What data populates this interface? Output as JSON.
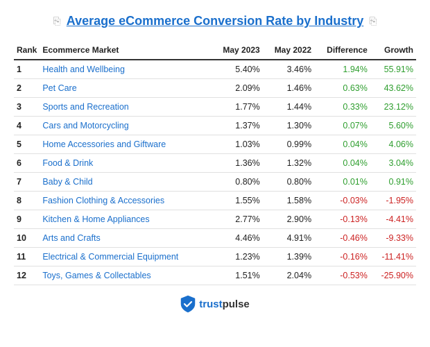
{
  "title": "Average eCommerce Conversion Rate by Industry",
  "table": {
    "headers": [
      "Rank",
      "Ecommerce Market",
      "May 2023",
      "May 2022",
      "Difference",
      "Growth"
    ],
    "rows": [
      {
        "rank": "1",
        "market": "Health and Wellbeing",
        "may2023": "5.40%",
        "may2022": "3.46%",
        "diff": "1.94%",
        "diffSign": "pos",
        "growth": "55.91%",
        "growthSign": "pos"
      },
      {
        "rank": "2",
        "market": "Pet Care",
        "may2023": "2.09%",
        "may2022": "1.46%",
        "diff": "0.63%",
        "diffSign": "pos",
        "growth": "43.62%",
        "growthSign": "pos"
      },
      {
        "rank": "3",
        "market": "Sports and Recreation",
        "may2023": "1.77%",
        "may2022": "1.44%",
        "diff": "0.33%",
        "diffSign": "pos",
        "growth": "23.12%",
        "growthSign": "pos"
      },
      {
        "rank": "4",
        "market": "Cars and Motorcycling",
        "may2023": "1.37%",
        "may2022": "1.30%",
        "diff": "0.07%",
        "diffSign": "pos",
        "growth": "5.60%",
        "growthSign": "pos"
      },
      {
        "rank": "5",
        "market": "Home Accessories and Giftware",
        "may2023": "1.03%",
        "may2022": "0.99%",
        "diff": "0.04%",
        "diffSign": "pos",
        "growth": "4.06%",
        "growthSign": "pos"
      },
      {
        "rank": "6",
        "market": "Food & Drink",
        "may2023": "1.36%",
        "may2022": "1.32%",
        "diff": "0.04%",
        "diffSign": "pos",
        "growth": "3.04%",
        "growthSign": "pos"
      },
      {
        "rank": "7",
        "market": "Baby & Child",
        "may2023": "0.80%",
        "may2022": "0.80%",
        "diff": "0.01%",
        "diffSign": "pos",
        "growth": "0.91%",
        "growthSign": "pos"
      },
      {
        "rank": "8",
        "market": "Fashion Clothing & Accessories",
        "may2023": "1.55%",
        "may2022": "1.58%",
        "diff": "-0.03%",
        "diffSign": "neg",
        "growth": "-1.95%",
        "growthSign": "neg"
      },
      {
        "rank": "9",
        "market": "Kitchen & Home Appliances",
        "may2023": "2.77%",
        "may2022": "2.90%",
        "diff": "-0.13%",
        "diffSign": "neg",
        "growth": "-4.41%",
        "growthSign": "neg"
      },
      {
        "rank": "10",
        "market": "Arts and Crafts",
        "may2023": "4.46%",
        "may2022": "4.91%",
        "diff": "-0.46%",
        "diffSign": "neg",
        "growth": "-9.33%",
        "growthSign": "neg"
      },
      {
        "rank": "11",
        "market": "Electrical & Commercial Equipment",
        "may2023": "1.23%",
        "may2022": "1.39%",
        "diff": "-0.16%",
        "diffSign": "neg",
        "growth": "-11.41%",
        "growthSign": "neg"
      },
      {
        "rank": "12",
        "market": "Toys, Games & Collectables",
        "may2023": "1.51%",
        "may2022": "2.04%",
        "diff": "-0.53%",
        "diffSign": "neg",
        "growth": "-25.90%",
        "growthSign": "neg"
      }
    ]
  },
  "footer": {
    "brand": "trustpulse"
  }
}
